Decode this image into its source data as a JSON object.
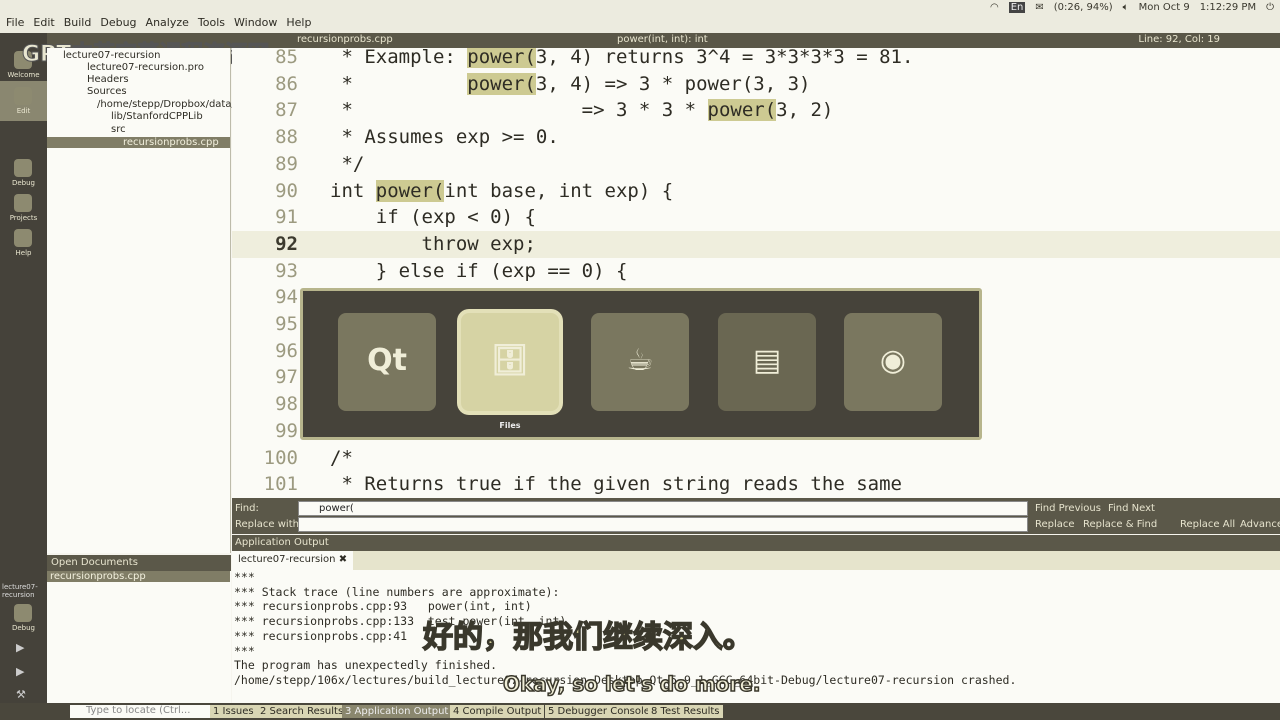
{
  "menu": [
    "File",
    "Edit",
    "Build",
    "Debug",
    "Analyze",
    "Tools",
    "Window",
    "Help"
  ],
  "tray": {
    "battery": "(0:26, 94%)",
    "date": "Mon Oct 9",
    "time": "1:12:29 PM",
    "lang": "En"
  },
  "tabbar": {
    "file": "recursionprobs.cpp",
    "symbol": "power(int, int): int",
    "position": "Line: 92, Col: 19"
  },
  "watermark": "GPT中英字幕课程资源网",
  "modes": [
    "Welcome",
    "Edit",
    "Debug",
    "Projects",
    "Help"
  ],
  "kit": {
    "name": "lecture07-recursion",
    "mode": "Debug"
  },
  "tree": [
    "lecture07-recursion",
    "lecture07-recursion.pro",
    "Headers",
    "Sources",
    "/home/stepp/Dropbox/data/",
    "lib/StanfordCPPLib",
    "src",
    "recursionprobs.cpp"
  ],
  "code": [
    {
      "n": "85",
      "pre": " * Example: ",
      "hl": "power(",
      "post": "3, 4) returns 3^4 = 3*3*3*3 = 81."
    },
    {
      "n": "86",
      "pre": " *          ",
      "hl": "power(",
      "post": "3, 4) => 3 * power(3, 3)"
    },
    {
      "n": "87",
      "pre": " *                    => 3 * 3 * ",
      "hl": "power(",
      "post": "3, 2)"
    },
    {
      "n": "88",
      "pre": " * Assumes exp >= 0.",
      "hl": "",
      "post": ""
    },
    {
      "n": "89",
      "pre": " */",
      "hl": "",
      "post": ""
    },
    {
      "n": "90",
      "pre": "int ",
      "hl": "power(",
      "post": "int base, int exp) {"
    },
    {
      "n": "91",
      "pre": "    if (exp < 0) {",
      "hl": "",
      "post": ""
    },
    {
      "n": "92",
      "pre": "        throw exp;",
      "hl": "",
      "post": ""
    },
    {
      "n": "93",
      "pre": "    } else if (exp == 0) {",
      "hl": "",
      "post": ""
    },
    {
      "n": "94",
      "pre": "",
      "hl": "",
      "post": ""
    },
    {
      "n": "95",
      "pre": "",
      "hl": "",
      "post": ""
    },
    {
      "n": "96",
      "pre": "",
      "hl": "",
      "post": ""
    },
    {
      "n": "97",
      "pre": "",
      "hl": "",
      "post": ""
    },
    {
      "n": "98",
      "pre": "",
      "hl": "",
      "post": ""
    },
    {
      "n": "99",
      "pre": "",
      "hl": "",
      "post": ""
    },
    {
      "n": "100",
      "pre": "/*",
      "hl": "",
      "post": ""
    },
    {
      "n": "101",
      "pre": " * Returns true if the given string reads the same",
      "hl": "",
      "post": ""
    }
  ],
  "switcher": {
    "apps": [
      "Qt",
      "",
      "",
      "",
      ""
    ],
    "selected_label": "Files"
  },
  "find": {
    "find_label": "Find:",
    "find_value": "power(",
    "replace_label": "Replace with:",
    "find_previous": "Find Previous",
    "find_next": "Find Next",
    "replace": "Replace",
    "replace_find": "Replace & Find",
    "replace_all": "Replace All",
    "advanced": "Advanced..."
  },
  "output": {
    "header": "Application Output",
    "tab": "lecture07-recursion",
    "lines": [
      "***",
      "*** Stack trace (line numbers are approximate):",
      "*** recursionprobs.cpp:93   power(int, int)",
      "*** recursionprobs.cpp:133  test_power(int, int)",
      "*** recursionprobs.cpp:41",
      "***",
      "The program has unexpectedly finished.",
      "/home/stepp/106x/lectures/build_lecture07-recursion-Desktop_Qt_5_9_1_GCC_64bit-Debug/lecture07-recursion crashed."
    ]
  },
  "open_documents": {
    "header": "Open Documents",
    "items": [
      "recursionprobs.cpp"
    ]
  },
  "status": {
    "locate_placeholder": "Type to locate (Ctrl...",
    "tabs": [
      "1 Issues",
      "2 Search Results",
      "3 Application Output",
      "4 Compile Output",
      "5 Debugger Console",
      "8 Test Results"
    ]
  },
  "subtitles": {
    "zh": "好的，那我们继续深入。",
    "en": "Okay, so let's do more."
  }
}
